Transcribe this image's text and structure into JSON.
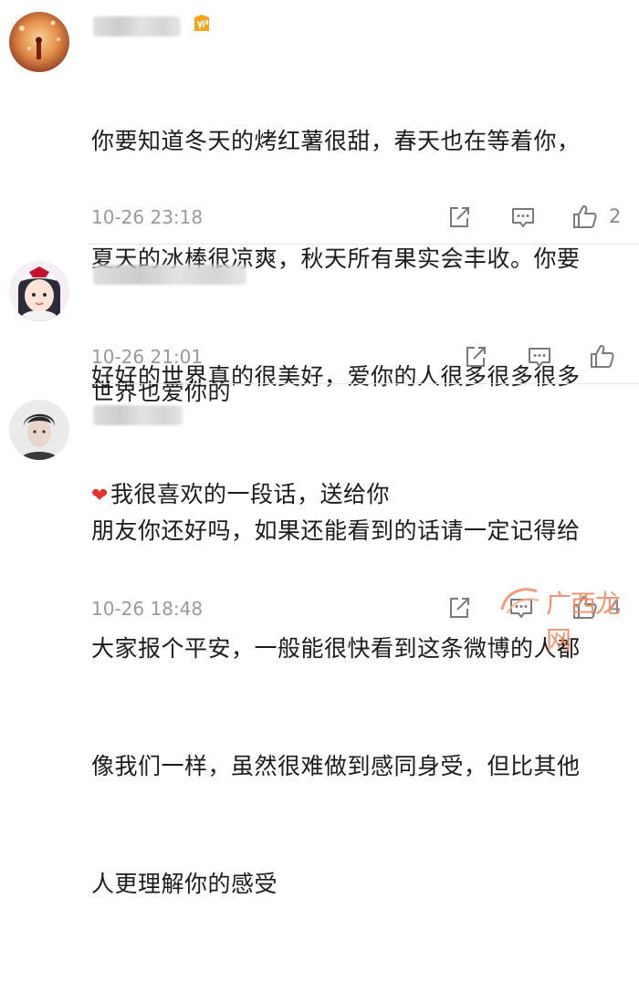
{
  "comments": [
    {
      "text_lines": [
        "你要知道冬天的烤红薯很甜，春天也在等着你，",
        "夏天的冰棒很凉爽，秋天所有果实会丰收。你要",
        "好好的世界真的很美好，爱你的人很多很多很多"
      ],
      "last_line": "我很喜欢的一段话，送给你",
      "time": "10-26 23:18",
      "like_count": "2"
    },
    {
      "text_lines": [
        "世界也爱你的"
      ],
      "time": "10-26 21:01",
      "like_count": ""
    },
    {
      "text_lines": [
        "朋友你还好吗，如果还能看到的话请一定记得给",
        "大家报个平安，一般能很快看到这条微博的人都",
        "像我们一样，虽然很难做到感同身受，但比其他",
        "人更理解你的感受"
      ],
      "time": "10-26 18:48",
      "like_count": "4"
    }
  ],
  "icons": {
    "share": "share-icon",
    "comment": "comment-icon",
    "like": "thumbs-up-icon",
    "heart": "heart-icon",
    "vip": "vip-badge-icon"
  },
  "colors": {
    "heart": "#e8332f",
    "watermark": "#f08a63",
    "time": "#9a9a9a"
  },
  "watermark": {
    "text": "广西龙网"
  }
}
